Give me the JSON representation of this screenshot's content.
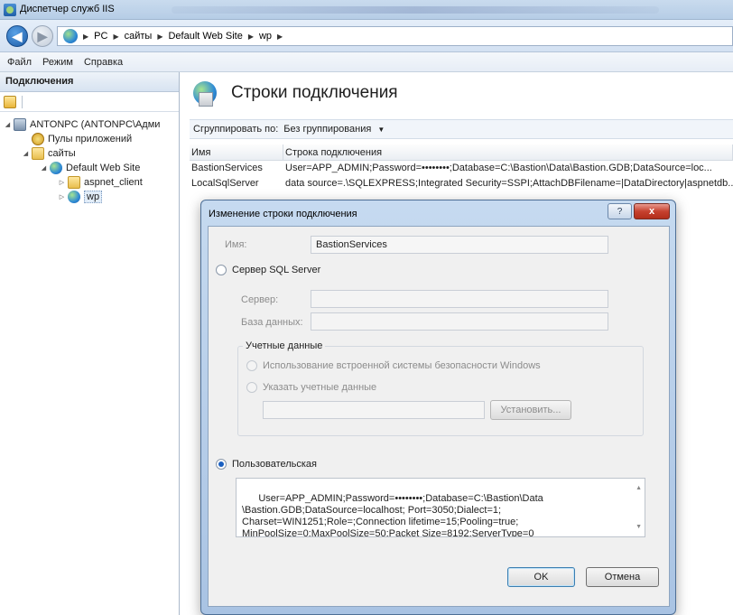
{
  "window": {
    "title": "Диспетчер служб IIS"
  },
  "address": {
    "crumbs": [
      "PC",
      "сайты",
      "Default Web Site",
      "wp"
    ]
  },
  "menu": {
    "items": [
      "Файл",
      "Режим",
      "Справка"
    ]
  },
  "connections": {
    "header": "Подключения",
    "tree": {
      "server": "ANTONPC (ANTONPC\\Адми",
      "pools": "Пулы приложений",
      "sites": "сайты",
      "site": "Default Web Site",
      "aspnet": "aspnet_client",
      "wp": "wp"
    }
  },
  "page": {
    "title": "Строки подключения",
    "group_label": "Сгруппировать по:",
    "group_value": "Без группирования",
    "columns": [
      "Имя",
      "Строка подключения"
    ],
    "rows": [
      {
        "name": "BastionServices",
        "value": "User=APP_ADMIN;Password=••••••••;Database=C:\\Bastion\\Data\\Bastion.GDB;DataSource=loc..."
      },
      {
        "name": "LocalSqlServer",
        "value": "data source=.\\SQLEXPRESS;Integrated Security=SSPI;AttachDBFilename=|DataDirectory|aspnetdb...."
      }
    ]
  },
  "dialog": {
    "title": "Изменение строки подключения",
    "help": "?",
    "close": "x",
    "name_label": "Имя:",
    "name_value": "BastionServices",
    "sql_option": "Сервер SQL Server",
    "server_label": "Сервер:",
    "db_label": "База данных:",
    "credentials_legend": "Учетные данные",
    "windows_security": "Использование встроенной системы безопасности Windows",
    "specify_credentials": "Указать учетные данные",
    "set_button": "Установить...",
    "custom_option": "Пользовательская",
    "custom_text": "User=APP_ADMIN;Password=••••••••;Database=C:\\Bastion\\Data\n\\Bastion.GDB;DataSource=localhost; Port=3050;Dialect=1;\nCharset=WIN1251;Role=;Connection lifetime=15;Pooling=true;\nMinPoolSize=0;MaxPoolSize=50;Packet Size=8192;ServerType=0",
    "ok": "OK",
    "cancel": "Отмена"
  }
}
